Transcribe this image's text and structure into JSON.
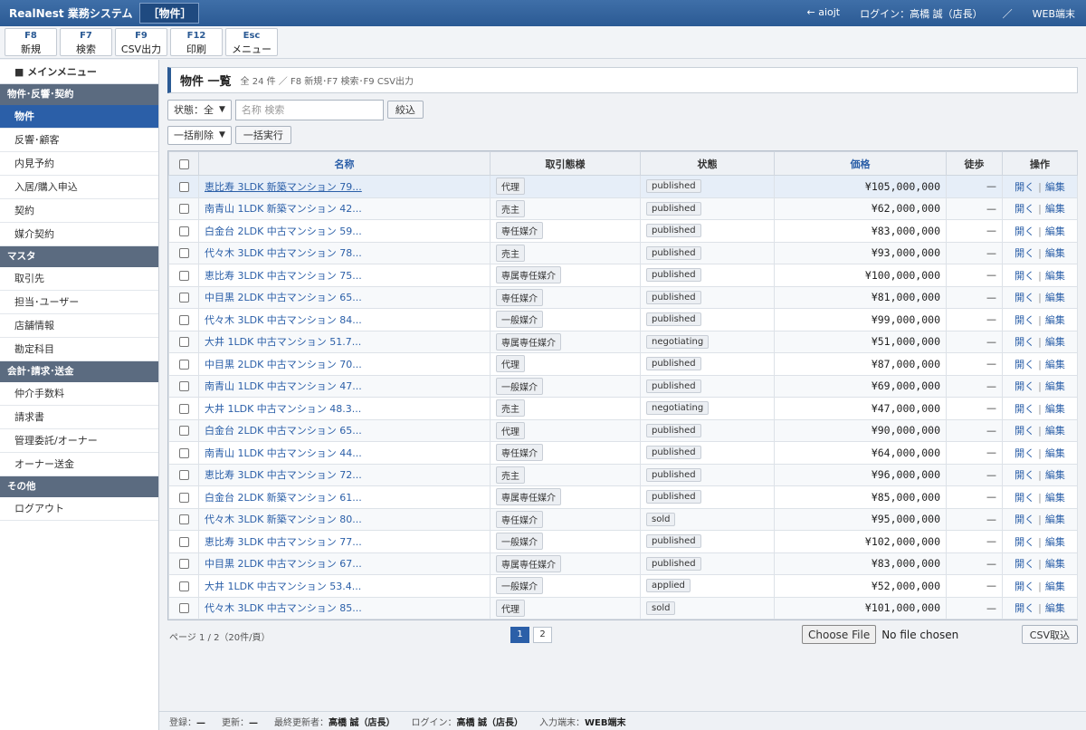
{
  "app": {
    "title": "RealNest 業務システム",
    "screen": "［物件］",
    "back_link": "← aiojt",
    "login": "ログイン：高橋 誠（店長）",
    "separator": "／",
    "terminal": "WEB端末"
  },
  "fkeys": [
    {
      "key": "F8",
      "label": "新規"
    },
    {
      "key": "F7",
      "label": "検索"
    },
    {
      "key": "F9",
      "label": "CSV出力"
    },
    {
      "key": "F12",
      "label": "印刷"
    },
    {
      "key": "Esc",
      "label": "メニュー"
    }
  ],
  "sidebar": {
    "main_menu": "■ メインメニュー",
    "groups": [
      {
        "title": "物件･反響･契約",
        "items": [
          "物件",
          "反響･顧客",
          "内見予約",
          "入居/購入申込",
          "契約",
          "媒介契約"
        ]
      },
      {
        "title": "マスタ",
        "items": [
          "取引先",
          "担当･ユーザー",
          "店舗情報",
          "勘定科目"
        ]
      },
      {
        "title": "会計･請求･送金",
        "items": [
          "仲介手数料",
          "請求書",
          "管理委託/オーナー",
          "オーナー送金"
        ]
      },
      {
        "title": "その他",
        "items": [
          "ログアウト"
        ]
      }
    ],
    "active": "物件"
  },
  "panel": {
    "title": "物件 一覧",
    "subtitle": "全 24 件 ／ F8 新規･F7 検索･F9 CSV出力"
  },
  "filter": {
    "status_select": "状態：全",
    "search_placeholder": "名称 検索",
    "search_button": "絞込"
  },
  "bulk": {
    "select": "一括削除",
    "button": "一括実行"
  },
  "table": {
    "columns": [
      "名称",
      "取引態様",
      "状態",
      "価格",
      "徒歩",
      "操作"
    ],
    "open_label": "開く",
    "op_sep": "|",
    "edit_label": "編集",
    "rows": [
      {
        "name": "恵比寿 3LDK 新築マンション 79...",
        "type": "代理",
        "status": "published",
        "price": "¥105,000,000",
        "walk": "—"
      },
      {
        "name": "南青山 1LDK 新築マンション 42...",
        "type": "売主",
        "status": "published",
        "price": "¥62,000,000",
        "walk": "—"
      },
      {
        "name": "白金台 2LDK 中古マンション 59...",
        "type": "専任媒介",
        "status": "published",
        "price": "¥83,000,000",
        "walk": "—"
      },
      {
        "name": "代々木 3LDK 中古マンション 78...",
        "type": "売主",
        "status": "published",
        "price": "¥93,000,000",
        "walk": "—"
      },
      {
        "name": "恵比寿 3LDK 中古マンション 75...",
        "type": "専属専任媒介",
        "status": "published",
        "price": "¥100,000,000",
        "walk": "—"
      },
      {
        "name": "中目黒 2LDK 中古マンション 65...",
        "type": "専任媒介",
        "status": "published",
        "price": "¥81,000,000",
        "walk": "—"
      },
      {
        "name": "代々木 3LDK 中古マンション 84...",
        "type": "一般媒介",
        "status": "published",
        "price": "¥99,000,000",
        "walk": "—"
      },
      {
        "name": "大井 1LDK 中古マンション 51.7...",
        "type": "専属専任媒介",
        "status": "negotiating",
        "price": "¥51,000,000",
        "walk": "—"
      },
      {
        "name": "中目黒 2LDK 中古マンション 70...",
        "type": "代理",
        "status": "published",
        "price": "¥87,000,000",
        "walk": "—"
      },
      {
        "name": "南青山 1LDK 中古マンション 47...",
        "type": "一般媒介",
        "status": "published",
        "price": "¥69,000,000",
        "walk": "—"
      },
      {
        "name": "大井 1LDK 中古マンション 48.3...",
        "type": "売主",
        "status": "negotiating",
        "price": "¥47,000,000",
        "walk": "—"
      },
      {
        "name": "白金台 2LDK 中古マンション 65...",
        "type": "代理",
        "status": "published",
        "price": "¥90,000,000",
        "walk": "—"
      },
      {
        "name": "南青山 1LDK 中古マンション 44...",
        "type": "専任媒介",
        "status": "published",
        "price": "¥64,000,000",
        "walk": "—"
      },
      {
        "name": "恵比寿 3LDK 中古マンション 72...",
        "type": "売主",
        "status": "published",
        "price": "¥96,000,000",
        "walk": "—"
      },
      {
        "name": "白金台 2LDK 新築マンション 61...",
        "type": "専属専任媒介",
        "status": "published",
        "price": "¥85,000,000",
        "walk": "—"
      },
      {
        "name": "代々木 3LDK 新築マンション 80...",
        "type": "専任媒介",
        "status": "sold",
        "price": "¥95,000,000",
        "walk": "—"
      },
      {
        "name": "恵比寿 3LDK 中古マンション 77...",
        "type": "一般媒介",
        "status": "published",
        "price": "¥102,000,000",
        "walk": "—"
      },
      {
        "name": "中目黒 2LDK 中古マンション 67...",
        "type": "専属専任媒介",
        "status": "published",
        "price": "¥83,000,000",
        "walk": "—"
      },
      {
        "name": "大井 1LDK 中古マンション 53.4...",
        "type": "一般媒介",
        "status": "applied",
        "price": "¥52,000,000",
        "walk": "—"
      },
      {
        "name": "代々木 3LDK 中古マンション 85...",
        "type": "代理",
        "status": "sold",
        "price": "¥101,000,000",
        "walk": "—"
      }
    ]
  },
  "pager": {
    "info": "ページ 1 / 2（20件/頁）",
    "pages": [
      "1",
      "2"
    ],
    "current": "1"
  },
  "file": {
    "button": "Choose File",
    "status": "No file chosen",
    "import_button": "CSV取込"
  },
  "footer": {
    "registered_label": "登録：",
    "registered": "—",
    "updated_label": "更新：",
    "updated": "—",
    "last_editor_label": "最終更新者：",
    "last_editor": "高橋 誠（店長）",
    "login_label": "ログイン：",
    "login": "高橋 誠（店長）",
    "terminal_label": "入力端末：",
    "terminal": "WEB端末"
  }
}
